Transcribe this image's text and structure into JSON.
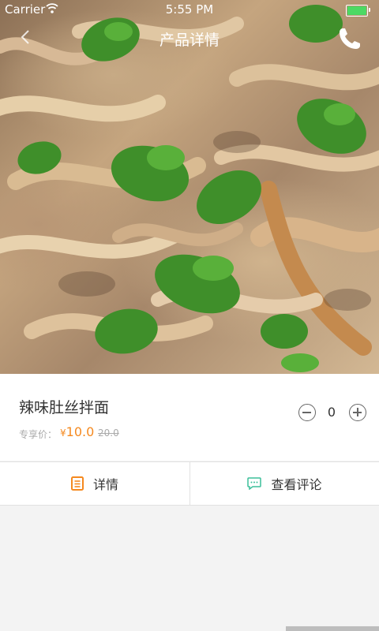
{
  "status_bar": {
    "carrier": "Carrier",
    "time": "5:55 PM"
  },
  "nav": {
    "title": "产品详情",
    "back_icon": "chevron-left-icon",
    "call_icon": "phone-icon"
  },
  "product": {
    "name": "辣味肚丝拌面",
    "price_label": "专享价：",
    "currency": "¥",
    "price": "10.0",
    "original_price": "20.0",
    "quantity": "0"
  },
  "tabs": [
    {
      "label": "详情",
      "icon": "document-icon",
      "icon_color": "#f5891f"
    },
    {
      "label": "查看评论",
      "icon": "comment-icon",
      "icon_color": "#3cbf9a"
    }
  ],
  "colors": {
    "accent": "#f5891f",
    "battery": "#4cd964"
  }
}
